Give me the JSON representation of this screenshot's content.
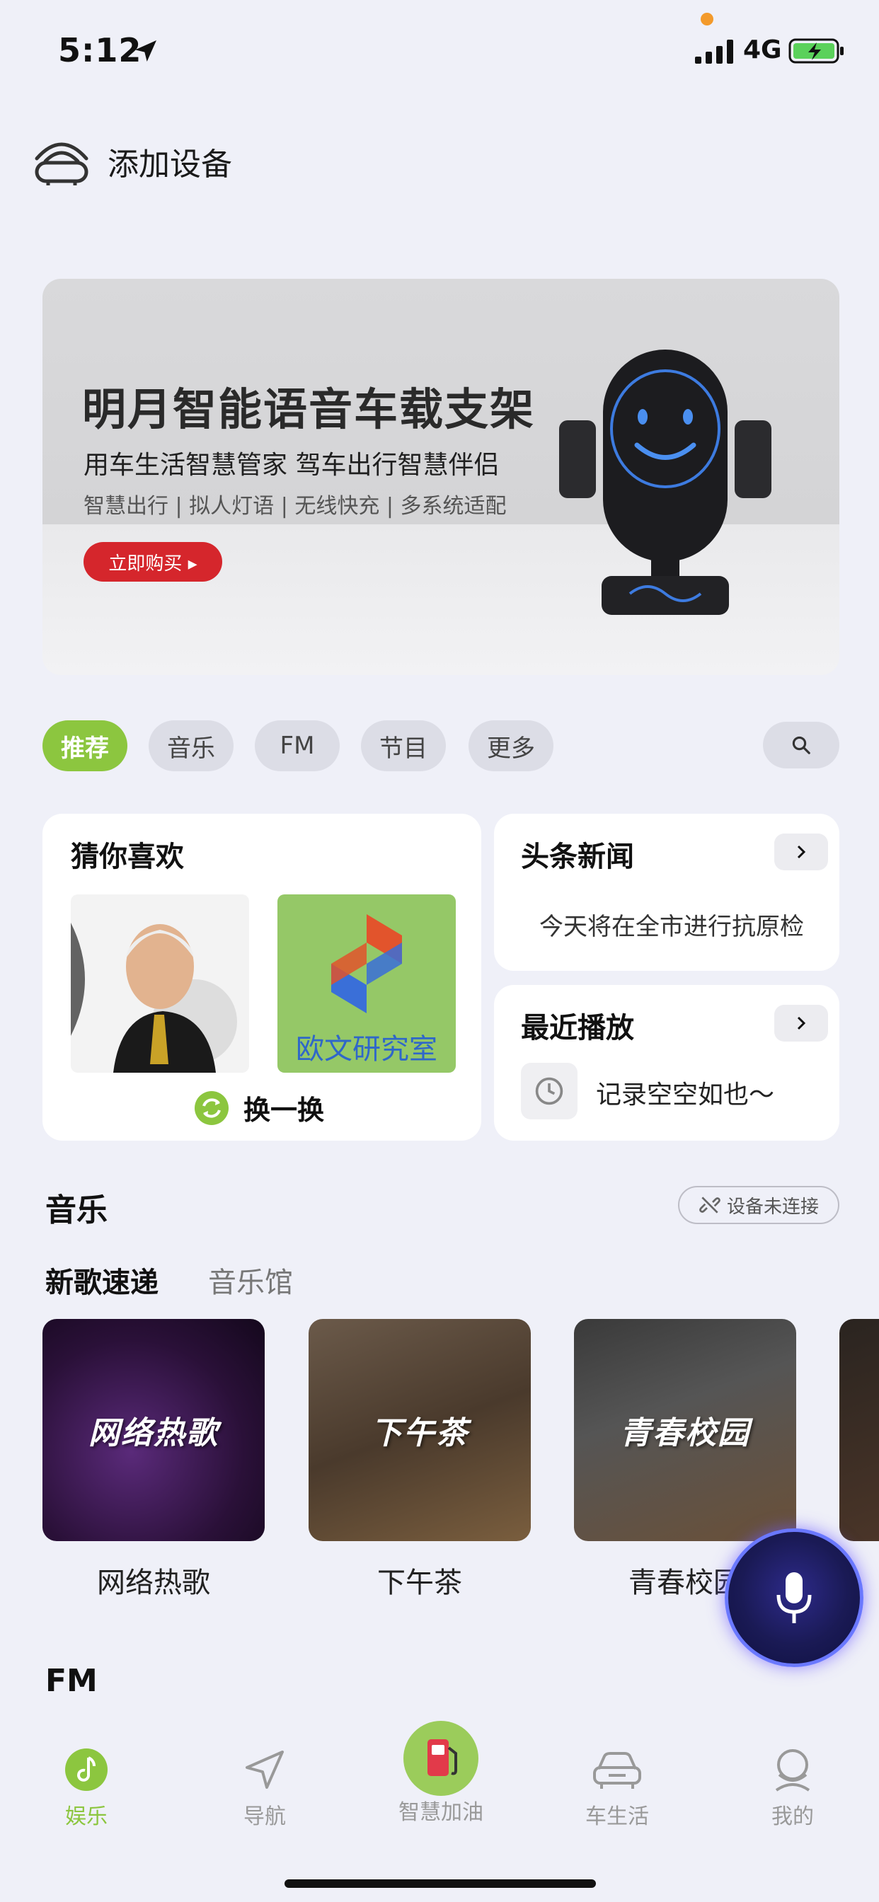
{
  "status_bar": {
    "time": "5:12",
    "network": "4G"
  },
  "header": {
    "add_device_label": "添加设备"
  },
  "banner": {
    "title": "明月智能语音车载支架",
    "subtitle": "用车生活智慧管家  驾车出行智慧伴侣",
    "tags": "智慧出行 | 拟人灯语 | 无线快充 | 多系统适配",
    "buy_label": "立即购买 ▸"
  },
  "category_tabs": [
    {
      "label": "推荐",
      "active": true
    },
    {
      "label": "音乐",
      "active": false
    },
    {
      "label": "FM",
      "active": false
    },
    {
      "label": "节目",
      "active": false
    },
    {
      "label": "更多",
      "active": false
    }
  ],
  "recommend_card": {
    "title": "猜你喜欢",
    "thumb2_text": "欧文研究室",
    "refresh_label": "换一换"
  },
  "news_card": {
    "title": "头条新闻",
    "headline": "今天将在全市进行抗原检"
  },
  "recent_card": {
    "title": "最近播放",
    "empty_text": "记录空空如也～"
  },
  "music_section": {
    "title": "音乐",
    "device_status": "设备未连接",
    "sub_tabs": [
      "新歌速递",
      "音乐馆"
    ],
    "albums": [
      {
        "overlay": "网络热歌",
        "label": "网络热歌"
      },
      {
        "overlay": "下午茶",
        "label": "下午茶"
      },
      {
        "overlay": "青春校园",
        "label": "青春校园"
      }
    ]
  },
  "fm_section": {
    "title": "FM"
  },
  "bottom_nav": [
    {
      "label": "娱乐",
      "icon": "music-note-icon",
      "active": true
    },
    {
      "label": "导航",
      "icon": "navigation-arrow-icon",
      "active": false
    },
    {
      "label": "智慧加油",
      "icon": "fuel-pump-icon",
      "active": false
    },
    {
      "label": "车生活",
      "icon": "car-icon",
      "active": false
    },
    {
      "label": "我的",
      "icon": "profile-icon",
      "active": false
    }
  ],
  "colors": {
    "accent": "#8cc63f",
    "buy_button": "#d5262c",
    "background": "#eff0f8"
  }
}
